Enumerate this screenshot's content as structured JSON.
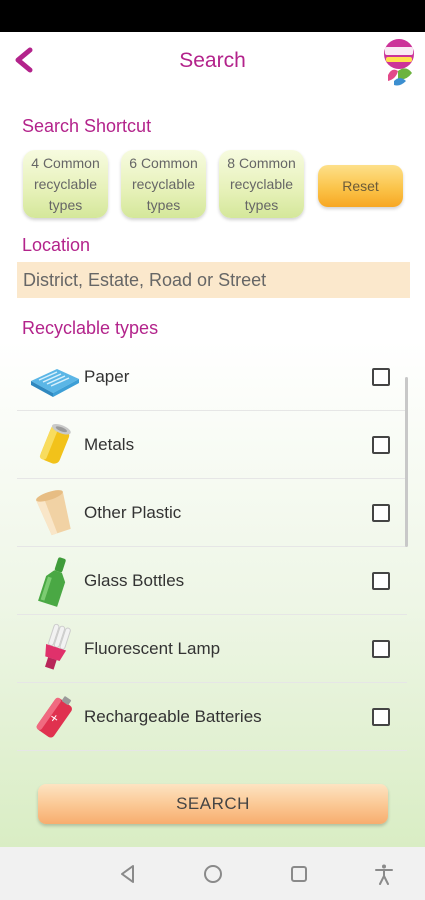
{
  "header": {
    "title": "Search",
    "back_icon": "chevron-left-icon",
    "logo_icon": "waste-less-logo"
  },
  "shortcut": {
    "label": "Search Shortcut",
    "buttons": [
      {
        "label": "4 Common recyclable types"
      },
      {
        "label": "6 Common recyclable types"
      },
      {
        "label": "8 Common recyclable types"
      }
    ],
    "reset_label": "Reset"
  },
  "location": {
    "label": "Location",
    "placeholder": "District, Estate, Road or Street",
    "value": ""
  },
  "recyclable": {
    "label": "Recyclable types",
    "items": [
      {
        "label": "Paper",
        "icon": "paper-icon",
        "checked": false
      },
      {
        "label": "Metals",
        "icon": "metal-can-icon",
        "checked": false
      },
      {
        "label": "Other Plastic",
        "icon": "plastic-cup-icon",
        "checked": false
      },
      {
        "label": "Glass Bottles",
        "icon": "glass-bottle-icon",
        "checked": false
      },
      {
        "label": "Fluorescent Lamp",
        "icon": "fluorescent-lamp-icon",
        "checked": false
      },
      {
        "label": "Rechargeable Batteries",
        "icon": "battery-icon",
        "checked": false
      }
    ]
  },
  "search_button": {
    "label": "SEARCH"
  },
  "colors": {
    "accent": "#b3238b",
    "location_bg": "#fbe8cc",
    "reset": "#fbc44a",
    "search": "#fbc996"
  },
  "navbar": {
    "icons": [
      "back-triangle-icon",
      "home-circle-icon",
      "recents-square-icon",
      "accessibility-icon"
    ]
  }
}
